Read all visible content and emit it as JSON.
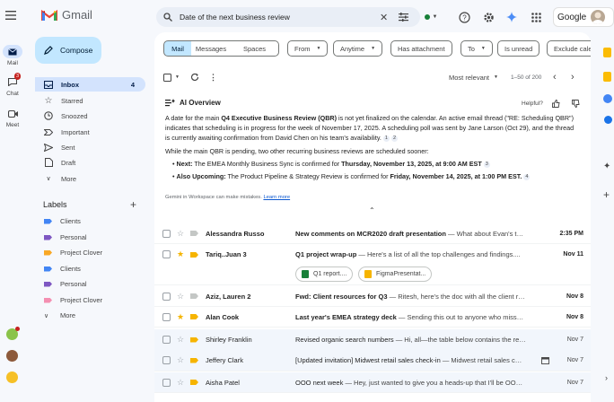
{
  "app": {
    "name": "Gmail"
  },
  "search": {
    "value": "Date of the next business review"
  },
  "rail": [
    {
      "label": "Mail",
      "icon": "mail-icon"
    },
    {
      "label": "Chat",
      "icon": "chat-icon",
      "badge": "3"
    },
    {
      "label": "Meet",
      "icon": "video-icon"
    }
  ],
  "account": {
    "brand": "Google"
  },
  "compose": {
    "label": "Compose"
  },
  "nav": [
    {
      "label": "Inbox",
      "count": "4",
      "icon": "inbox-icon"
    },
    {
      "label": "Starred",
      "icon": "star-icon"
    },
    {
      "label": "Snoozed",
      "icon": "clock-icon"
    },
    {
      "label": "Important",
      "icon": "important-icon"
    },
    {
      "label": "Sent",
      "icon": "send-icon"
    },
    {
      "label": "Draft",
      "icon": "draft-icon"
    },
    {
      "label": "More",
      "icon": "chevron-down-icon"
    }
  ],
  "labels": {
    "title": "Labels",
    "items": [
      {
        "label": "Clients",
        "color": "#4285f4"
      },
      {
        "label": "Personal",
        "color": "#7e57c2"
      },
      {
        "label": "Project Clover",
        "color": "#f9a825"
      },
      {
        "label": "Clients",
        "color": "#4285f4"
      },
      {
        "label": "Personal",
        "color": "#7e57c2"
      },
      {
        "label": "Project Clover",
        "color": "#f48fb1"
      }
    ],
    "more": "More"
  },
  "filters": {
    "segments": [
      "Mail",
      "Messages",
      "Spaces"
    ],
    "chips": [
      "From",
      "Anytime",
      "Has attachment",
      "To",
      "Is unread",
      "Exclude cale"
    ]
  },
  "toolbar": {
    "sort": "Most relevant",
    "range": "1–50 of 200"
  },
  "ai": {
    "title": "AI Overview",
    "helpful": "Helpful?",
    "p1_a": "A date for the main ",
    "p1_b": "Q4 Executive Business Review (QBR)",
    "p1_c": " is not yet finalized on the calendar. An active email thread (\"RE: Scheduling QBR\") indicates that scheduling is in progress for the week of November 17, 2025. A scheduling poll was sent by Jane Larson (Oct 29), and the thread is currently awaiting confirmation from David Chen on his team's availability.",
    "p1_refs": [
      "1",
      "2"
    ],
    "p2": "While the main QBR is pending, two other recurring business reviews are scheduled sooner:",
    "b1_label": "Next:",
    "b1_text": " The EMEA Monthly Business Sync is confirmed for ",
    "b1_date": "Thursday, November 13, 2025, at 9:00 AM EST",
    "b1_ref": "3",
    "b2_label": "Also Upcoming:",
    "b2_text": " The Product Pipeline & Strategy Review is confirmed for ",
    "b2_date": "Friday, November 14, 2025, at 1:00 PM EST.",
    "b2_ref": "4",
    "note": "Gemini in Workspace can make mistakes. ",
    "learn_more": "Learn more"
  },
  "emails": [
    {
      "sender": "Alessandra Russo",
      "subject": "New comments on MCR2020 draft presentation",
      "snippet": " — What about Evan's t…",
      "date": "2:35 PM",
      "unread": true,
      "starred": false,
      "important": false
    },
    {
      "sender": "Tariq..Juan 3",
      "subject": "Q1 project wrap-up",
      "snippet": " — Here's a list of all the top challenges and findings....",
      "date": "Nov 11",
      "unread": true,
      "starred": true,
      "important": true
    },
    {
      "sender": "Aziz, Lauren 2",
      "subject": "Fwd: Client resources for Q3",
      "snippet": " — Ritesh, here's the doc with all the client r…",
      "date": "Nov 8",
      "unread": true,
      "starred": false,
      "important": false
    },
    {
      "sender": "Alan Cook",
      "subject": "Last year's EMEA strategy deck",
      "snippet": " — Sending this out to anyone who miss…",
      "date": "Nov 8",
      "unread": true,
      "starred": true,
      "important": true
    },
    {
      "sender": "Shirley Franklin",
      "subject": "Revised organic search numbers",
      "snippet": " — Hi, all—the table below contains the re…",
      "date": "Nov 7",
      "unread": false,
      "starred": false,
      "important": true
    },
    {
      "sender": "Jeffery Clark",
      "subject": "[Updated invitation] Midwest retail sales check-in",
      "snippet": " — Midwest retail sales c…",
      "date": "Nov 7",
      "unread": false,
      "starred": false,
      "important": true
    },
    {
      "sender": "Aisha Patel",
      "subject": "OOO next week",
      "snippet": " — Hey, just wanted to give you a heads-up that I'll be OO…",
      "date": "Nov 7",
      "unread": false,
      "starred": false,
      "important": true
    }
  ],
  "attachments": [
    {
      "name": "Q1 report....",
      "icon": "sheets-icon"
    },
    {
      "name": "FigmaPresentat...",
      "icon": "slides-icon"
    }
  ]
}
